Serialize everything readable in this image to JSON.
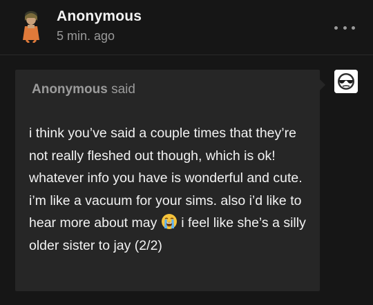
{
  "post": {
    "author": "Anonymous",
    "time": "5 min. ago"
  },
  "ask": {
    "asker_name": "Anonymous",
    "said_label": "said",
    "body_before_emoji": "i think you’ve said a couple times that they’re not really fleshed out though, which is ok! whatever info you have is wonderful and cute. i’m like a vacuum for your sims. also i’d like to hear more about may",
    "body_after_emoji": "i feel like she’s a silly older sister to jay (2/2)",
    "emoji": "loudly-crying-face"
  },
  "icons": {
    "more": "more-horizontal-icon",
    "answerer_avatar": "sunglasses-face-icon"
  },
  "colors": {
    "background": "#161616",
    "ask_box": "#262626",
    "muted_text": "#9b9b9b",
    "text": "#f2f2f2"
  }
}
